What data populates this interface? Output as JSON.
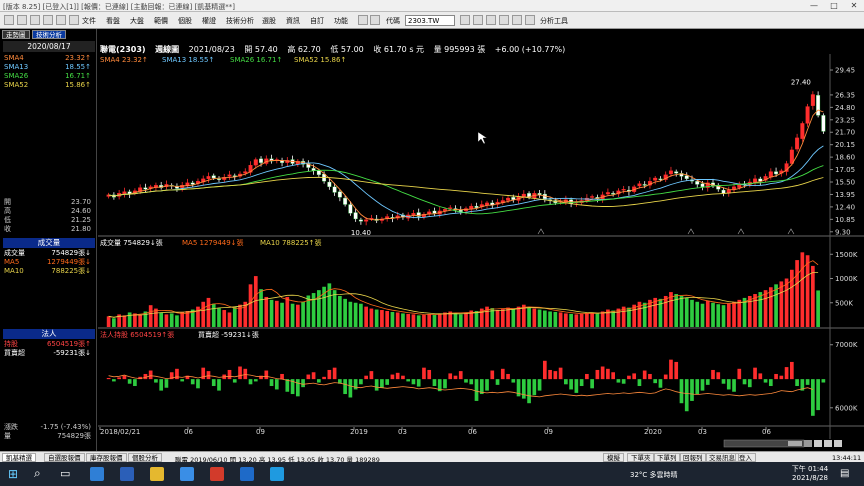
{
  "window": {
    "title": "[版本 8.25] [已登入[1]] [報價：已連線] [主動回報：已連線]  [凱基精選**]"
  },
  "menu": {
    "items": [
      "文件",
      "看盤",
      "大盤",
      "範價",
      "個股",
      "權證",
      "技術分析",
      "選股",
      "資訊",
      "自訂",
      "功能"
    ],
    "code_label": "代碼",
    "code_value": "2303.TW",
    "analysis_tool": "分析工具"
  },
  "left": {
    "tabs": [
      "走勢圖",
      "技術分析"
    ],
    "date": "2020/08/17",
    "sma": [
      {
        "label": "SMA4",
        "value": "23.32",
        "arrow": "↑",
        "color": "#ff8a3c"
      },
      {
        "label": "SMA13",
        "value": "18.55",
        "arrow": "↑",
        "color": "#6ec8ff"
      },
      {
        "label": "SMA26",
        "value": "16.71",
        "arrow": "↑",
        "color": "#44dd44"
      },
      {
        "label": "SMA52",
        "value": "15.86",
        "arrow": "↑",
        "color": "#e8d44a"
      }
    ],
    "ohlc": [
      {
        "label": "開",
        "value": "23.70"
      },
      {
        "label": "高",
        "value": "24.60"
      },
      {
        "label": "低",
        "value": "21.25"
      },
      {
        "label": "收",
        "value": "21.80"
      }
    ],
    "volume_header": "成交量",
    "volume_rows": [
      {
        "label": "成交量",
        "value": "754829張",
        "arrow": "↓",
        "color": "#ffffff"
      },
      {
        "label": "MA5",
        "value": "1279449張",
        "arrow": "↓",
        "color": "#ff6a1a"
      },
      {
        "label": "MA10",
        "value": "788225張",
        "arrow": "↓",
        "color": "#e8d44a"
      }
    ],
    "inst_header": "法人",
    "inst_rows": [
      {
        "label": "持股",
        "value": "6504519張",
        "arrow": "↑",
        "color": "#ff4444"
      },
      {
        "label": "買賣超",
        "value": "-59231張",
        "arrow": "↓",
        "color": "#ffffff"
      }
    ],
    "bottom": [
      {
        "label": "漲跌",
        "value": "-1.75 (-7.43%)"
      },
      {
        "label": "量",
        "value": "754829張"
      }
    ]
  },
  "header": {
    "stock": "聯電(2303)",
    "period": "週線圖",
    "date": "2021/08/23",
    "open": "開 57.40",
    "high": "高 62.70",
    "low": "低 57.00",
    "close": "收 61.70 s 元",
    "volume": "量 995993 張",
    "change": "+6.00 (+10.77%)"
  },
  "price_legend": [
    {
      "text": "SMA4 23.32↑",
      "color": "#ff8a3c"
    },
    {
      "text": "SMA13 18.55↑",
      "color": "#6ec8ff"
    },
    {
      "text": "SMA26 16.71↑",
      "color": "#44dd44"
    },
    {
      "text": "SMA52 15.86↑",
      "color": "#e8d44a"
    }
  ],
  "vol_legend": [
    {
      "text": "成交量 754829↓張",
      "color": "#ffffff"
    },
    {
      "text": "MA5 1279449↓張",
      "color": "#ff6a1a"
    },
    {
      "text": "MA10 788225↑張",
      "color": "#e8d44a"
    }
  ],
  "inst_legend": [
    {
      "text": "法人持股 6504519↑張",
      "color": "#ff4444"
    },
    {
      "text": "買賣超 -59231↓張",
      "color": "#ffffff"
    }
  ],
  "annotations": {
    "high": "27.40",
    "low": "10.40"
  },
  "chart_data": {
    "type": "candlestick",
    "title": "聯電(2303) 週線圖",
    "price_axis": {
      "ticks": [
        "29.45",
        "26.35",
        "24.80",
        "23.25",
        "21.70",
        "20.15",
        "18.60",
        "17.05",
        "15.50",
        "13.95",
        "12.40",
        "10.85",
        "9.30"
      ],
      "range": [
        8.9,
        30.2
      ]
    },
    "volume_axis": {
      "ticks": [
        "1500K",
        "1000K",
        "500K"
      ],
      "range": [
        0,
        1650
      ]
    },
    "inst_axis": {
      "ticks": [
        "7000K",
        "6000K"
      ],
      "range": [
        -800,
        700
      ]
    },
    "x_labels": [
      "2018/02/21",
      "06",
      "09",
      "2019",
      "03",
      "06",
      "09",
      "2020",
      "03",
      "06"
    ],
    "close": [
      13.9,
      13.6,
      14.1,
      14.3,
      14.0,
      14.4,
      14.8,
      14.6,
      14.9,
      15.1,
      14.8,
      15.2,
      15.0,
      14.7,
      15.1,
      15.4,
      15.2,
      15.6,
      15.9,
      16.2,
      16.0,
      15.8,
      16.1,
      16.4,
      16.2,
      16.5,
      16.8,
      17.6,
      18.3,
      17.9,
      18.4,
      18.1,
      18.3,
      17.9,
      18.2,
      17.8,
      18.1,
      17.7,
      17.3,
      16.9,
      16.4,
      15.6,
      14.9,
      14.2,
      13.6,
      12.7,
      11.6,
      10.9,
      10.6,
      10.8,
      11.0,
      10.7,
      10.9,
      11.2,
      11.0,
      11.3,
      11.1,
      11.4,
      11.6,
      11.2,
      11.5,
      11.8,
      11.6,
      11.9,
      12.1,
      12.3,
      12.0,
      11.8,
      12.2,
      12.5,
      12.3,
      12.7,
      12.9,
      12.6,
      13.0,
      13.2,
      13.5,
      13.3,
      13.7,
      14.0,
      13.6,
      14.1,
      13.9,
      13.4,
      13.2,
      12.9,
      13.1,
      13.3,
      12.8,
      13.0,
      13.2,
      13.5,
      13.7,
      13.4,
      13.9,
      14.2,
      14.0,
      14.4,
      14.6,
      14.3,
      14.9,
      15.3,
      15.1,
      15.6,
      16.0,
      15.8,
      16.4,
      16.9,
      16.6,
      16.2,
      15.9,
      15.6,
      15.2,
      14.9,
      15.4,
      15.0,
      14.6,
      14.1,
      14.5,
      14.9,
      15.3,
      15.1,
      15.5,
      15.9,
      15.6,
      16.2,
      16.8,
      16.5,
      16.9,
      17.8,
      19.5,
      21.0,
      22.8,
      24.9,
      26.4,
      23.8,
      21.8
    ],
    "volume": [
      220,
      180,
      260,
      240,
      300,
      280,
      250,
      320,
      450,
      380,
      300,
      260,
      280,
      240,
      310,
      330,
      360,
      420,
      520,
      600,
      480,
      390,
      350,
      300,
      420,
      460,
      520,
      880,
      1050,
      780,
      620,
      560,
      540,
      500,
      620,
      480,
      460,
      520,
      650,
      700,
      760,
      830,
      900,
      760,
      640,
      580,
      520,
      500,
      480,
      420,
      380,
      360,
      350,
      330,
      310,
      300,
      280,
      270,
      260,
      240,
      250,
      270,
      260,
      280,
      300,
      320,
      290,
      260,
      300,
      340,
      330,
      380,
      420,
      390,
      350,
      370,
      400,
      380,
      420,
      460,
      410,
      380,
      360,
      340,
      320,
      310,
      300,
      280,
      270,
      260,
      270,
      290,
      300,
      280,
      320,
      360,
      340,
      380,
      420,
      400,
      460,
      520,
      500,
      560,
      600,
      580,
      640,
      720,
      680,
      640,
      600,
      560,
      520,
      480,
      540,
      500,
      470,
      450,
      480,
      520,
      560,
      600,
      640,
      680,
      720,
      760,
      820,
      880,
      940,
      1000,
      1180,
      1380,
      1540,
      1480,
      1260,
      754
    ],
    "net_buy": [
      20,
      -40,
      30,
      60,
      -80,
      -120,
      40,
      90,
      150,
      -60,
      -200,
      -150,
      120,
      180,
      -40,
      60,
      -90,
      -160,
      200,
      140,
      -120,
      -200,
      80,
      160,
      -60,
      220,
      180,
      -90,
      -40,
      60,
      150,
      -120,
      -180,
      90,
      -220,
      -260,
      -300,
      -140,
      80,
      120,
      -60,
      40,
      160,
      200,
      -80,
      -260,
      -320,
      -180,
      -90,
      60,
      140,
      -200,
      -150,
      -100,
      80,
      110,
      60,
      -40,
      -90,
      -130,
      200,
      160,
      -120,
      -210,
      -160,
      100,
      60,
      140,
      -60,
      -90,
      -380,
      -260,
      -200,
      150,
      -100,
      180,
      90,
      -60,
      -300,
      -340,
      -420,
      -280,
      -200,
      320,
      160,
      140,
      200,
      -90,
      -180,
      -240,
      -120,
      90,
      -160,
      160,
      220,
      180,
      120,
      -60,
      -80,
      60,
      100,
      -120,
      150,
      90,
      -70,
      -150,
      80,
      340,
      300,
      -420,
      -560,
      -380,
      -260,
      -200,
      -100,
      160,
      120,
      -80,
      -180,
      -220,
      180,
      -90,
      -140,
      200,
      100,
      -60,
      -120,
      90,
      60,
      210,
      300,
      -120,
      -200,
      -100,
      -640,
      -540,
      -59
    ],
    "inst_holding": [
      60,
      40,
      50,
      70,
      40,
      20,
      10,
      30,
      60,
      50,
      30,
      10,
      20,
      40,
      30,
      50,
      40,
      20,
      40,
      60,
      50,
      30,
      40,
      50,
      40,
      60,
      80,
      70,
      50,
      40,
      50,
      30,
      10,
      0,
      -20,
      -40,
      -70,
      -90,
      -80,
      -70,
      -90,
      -100,
      -80,
      -60,
      -70,
      -90,
      -120,
      -140,
      -150,
      -130,
      -120,
      -140,
      -150,
      -160,
      -150,
      -140,
      -130,
      -140,
      -150,
      -170,
      -160,
      -150,
      -160,
      -180,
      -190,
      -180,
      -170,
      -160,
      -170,
      -180,
      -210,
      -230,
      -240,
      -230,
      -240,
      -230,
      -220,
      -230,
      -250,
      -270,
      -290,
      -300,
      -310,
      -290,
      -280,
      -270,
      -260,
      -270,
      -280,
      -290,
      -280,
      -290,
      -280,
      -270,
      -260,
      -250,
      -260,
      -250,
      -240,
      -250,
      -240,
      -230,
      -240,
      -250,
      -240,
      -200,
      -170,
      -190,
      -220,
      -240,
      -250,
      -260,
      -270,
      -260,
      -250,
      -260,
      -270,
      -280,
      -270,
      -280,
      -290,
      -280,
      -270,
      -280,
      -270,
      -260,
      -250,
      -230,
      -200,
      -210,
      -220,
      -190,
      -170,
      -150,
      -180
    ]
  },
  "bottom_tabs": [
    "凱基精選",
    "自選股報價",
    "庫存股報價",
    "個股分析"
  ],
  "ticker": "聯電 2019/06/10 開 13.20 高 13.95 低 13.05 收 13.70 量 189289",
  "right_tabs": [
    "模擬",
    "下單夾",
    "下單列",
    "回報列",
    "交易訊息",
    "登入"
  ],
  "status_time": "13:44:11",
  "weather": "32°C  多雲時晴",
  "clock": {
    "time": "下午 01:44",
    "date": "2021/8/28"
  }
}
